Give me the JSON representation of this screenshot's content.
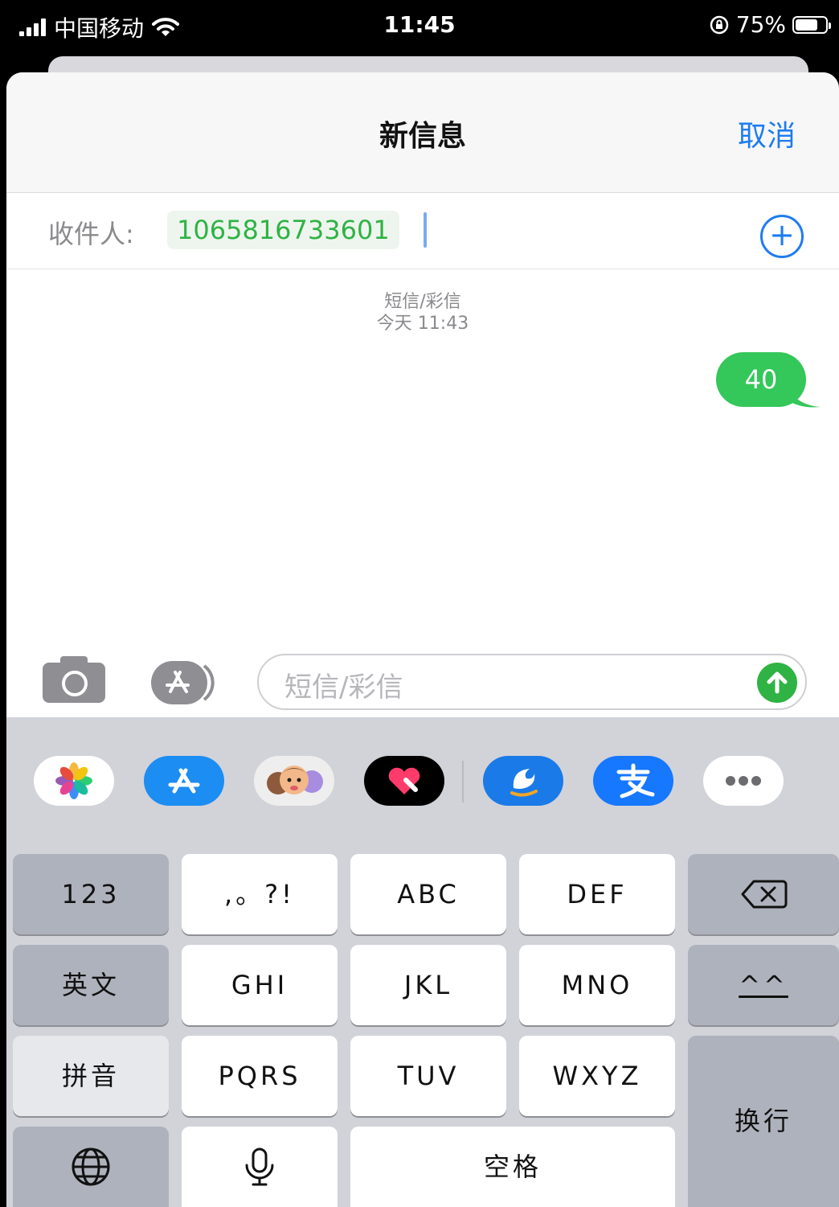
{
  "status_bar": {
    "carrier": "中国移动",
    "time": "11:45",
    "battery": "75%"
  },
  "nav": {
    "title": "新信息",
    "cancel": "取消"
  },
  "recipient": {
    "label": "收件人:",
    "number": "1065816733601"
  },
  "conversation": {
    "service": "短信/彩信",
    "timestamp": "今天 11:43",
    "message": "40"
  },
  "input": {
    "placeholder": "短信/彩信"
  },
  "app_drawer": [
    {
      "name": "photos-app-icon"
    },
    {
      "name": "app-store-icon"
    },
    {
      "name": "memoji-icon"
    },
    {
      "name": "digital-touch-icon"
    },
    {
      "name": "dolphin-app-icon"
    },
    {
      "name": "alipay-icon"
    },
    {
      "name": "more-apps-icon"
    }
  ],
  "keyboard": {
    "k123": "123",
    "punct": ",。?!",
    "abc": "ABC",
    "def": "DEF",
    "english": "英文",
    "ghi": "GHI",
    "jkl": "JKL",
    "mno": "MNO",
    "emoticon": "^^",
    "pinyin": "拼音",
    "pqrs": "PQRS",
    "tuv": "TUV",
    "wxyz": "WXYZ",
    "return": "换行",
    "space": "空格"
  },
  "colors": {
    "accent_blue": "#1e7cf0",
    "imessage_green": "#34c759",
    "recipient_green": "#2fb344"
  }
}
